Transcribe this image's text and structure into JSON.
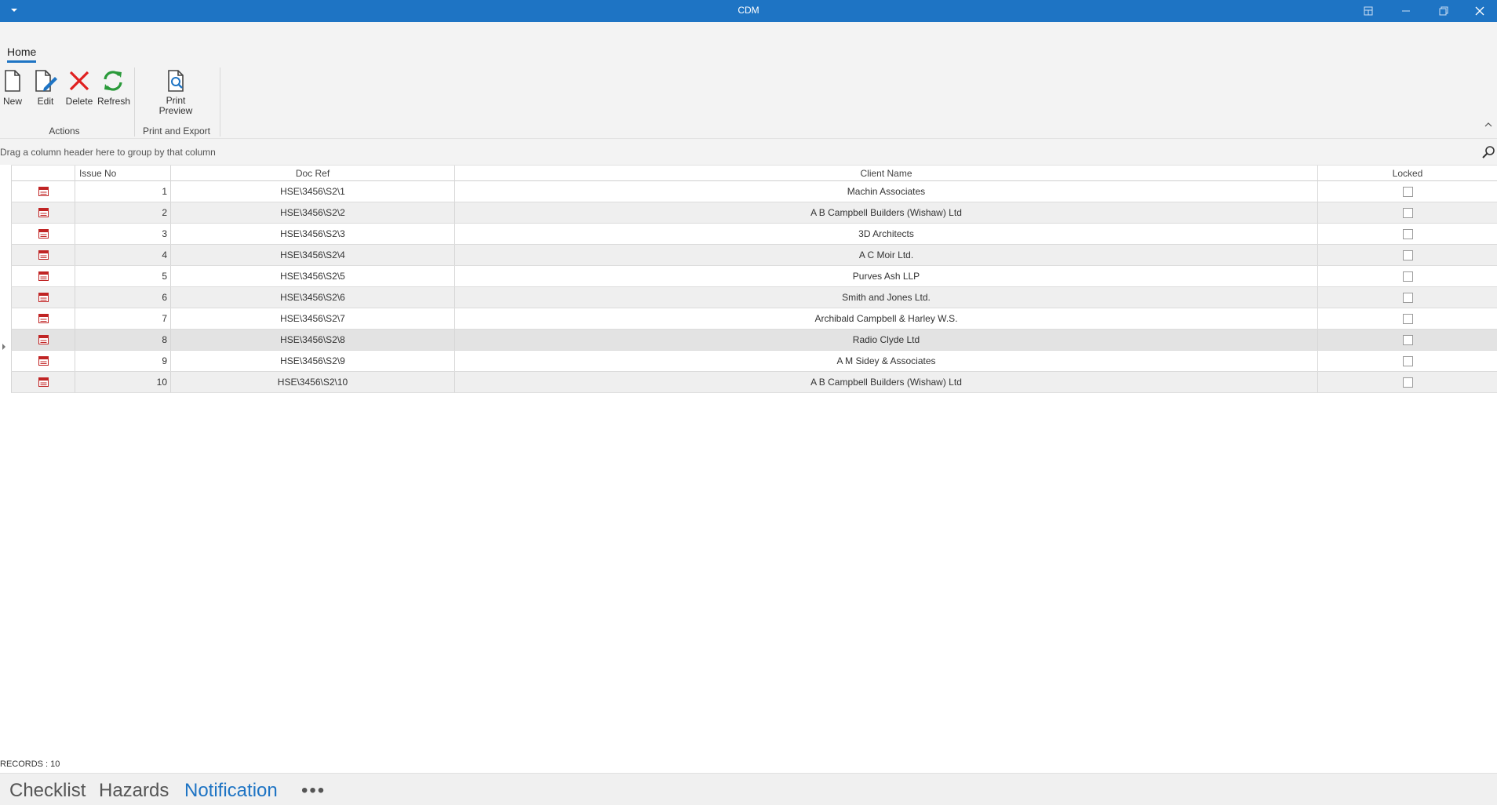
{
  "window": {
    "title": "CDM",
    "titlebar_color": "#1e74c4"
  },
  "ribbon": {
    "tab": "Home",
    "buttons": {
      "new": "New",
      "edit": "Edit",
      "delete": "Delete",
      "refresh": "Refresh",
      "print_preview_line1": "Print",
      "print_preview_line2": "Preview"
    },
    "groups": {
      "actions": "Actions",
      "print_export": "Print and Export"
    }
  },
  "grid": {
    "group_hint": "Drag a column header here to group by that column",
    "columns": {
      "issue_no": "Issue No",
      "doc_ref": "Doc Ref",
      "client_name": "Client Name",
      "locked": "Locked"
    },
    "rows": [
      {
        "issue": "1",
        "doc": "HSE\\3456\\S2\\1",
        "client": "Machin Associates",
        "locked": false
      },
      {
        "issue": "2",
        "doc": "HSE\\3456\\S2\\2",
        "client": "A B  Campbell Builders (Wishaw) Ltd",
        "locked": false
      },
      {
        "issue": "3",
        "doc": "HSE\\3456\\S2\\3",
        "client": "3D Architects",
        "locked": false
      },
      {
        "issue": "4",
        "doc": "HSE\\3456\\S2\\4",
        "client": "A C Moir Ltd.",
        "locked": false
      },
      {
        "issue": "5",
        "doc": "HSE\\3456\\S2\\5",
        "client": "Purves Ash LLP",
        "locked": false
      },
      {
        "issue": "6",
        "doc": "HSE\\3456\\S2\\6",
        "client": "Smith and Jones Ltd.",
        "locked": false
      },
      {
        "issue": "7",
        "doc": "HSE\\3456\\S2\\7",
        "client": "Archibald Campbell & Harley W.S.",
        "locked": false
      },
      {
        "issue": "8",
        "doc": "HSE\\3456\\S2\\8",
        "client": "Radio Clyde Ltd",
        "locked": false
      },
      {
        "issue": "9",
        "doc": "HSE\\3456\\S2\\9",
        "client": "A M Sidey & Associates",
        "locked": false
      },
      {
        "issue": "10",
        "doc": "HSE\\3456\\S2\\10",
        "client": "A B  Campbell Builders (Wishaw) Ltd",
        "locked": false
      }
    ],
    "selected_row_index": 7
  },
  "status": {
    "records": "RECORDS : 10"
  },
  "bottom_nav": {
    "items": [
      "Checklist",
      "Hazards",
      "Notification"
    ],
    "active": "Notification",
    "more": "•••"
  }
}
